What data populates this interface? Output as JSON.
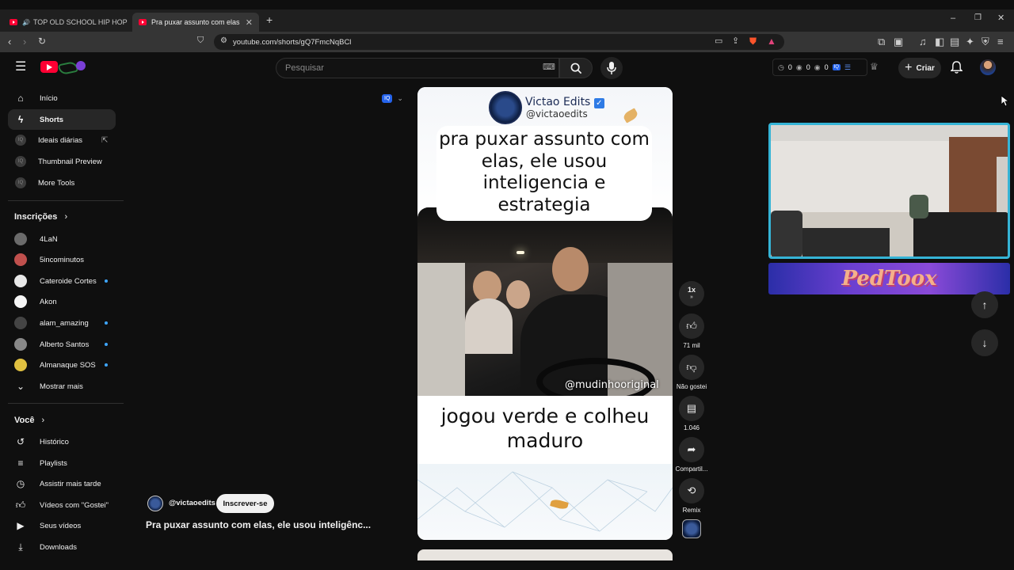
{
  "browser": {
    "tabs": [
      {
        "label": "TOP OLD SCHOOL HIP HOP 🔥 5",
        "active": false
      },
      {
        "label": "Pra puxar assunto com elas, ele",
        "active": true
      }
    ],
    "url": "youtube.com/shorts/gQ7FmcNqBCl"
  },
  "header": {
    "search_placeholder": "Pesquisar",
    "counters": [
      "0",
      "0",
      "0"
    ],
    "create_label": "Criar"
  },
  "sidebar": {
    "main": [
      {
        "label": "Início",
        "icon": "home-icon"
      },
      {
        "label": "Shorts",
        "icon": "shorts-icon",
        "selected": true
      },
      {
        "label": "Ideais diárias",
        "icon": "iq-icon"
      },
      {
        "label": "Thumbnail Preview",
        "icon": "iq-icon"
      },
      {
        "label": "More Tools",
        "icon": "iq-icon"
      }
    ],
    "subscriptions_title": "Inscrições",
    "subscriptions": [
      {
        "label": "4LaN",
        "color": "#6b6b6b",
        "new": false
      },
      {
        "label": "5incominutos",
        "color": "#c0504d",
        "new": false
      },
      {
        "label": "Cateroide Cortes",
        "color": "#e8e8e8",
        "new": true
      },
      {
        "label": "Akon",
        "color": "#f5f5f5",
        "new": false
      },
      {
        "label": "alam_amazing",
        "color": "#444444",
        "new": true
      },
      {
        "label": "Alberto Santos",
        "color": "#888888",
        "new": true
      },
      {
        "label": "Almanaque SOS",
        "color": "#e0c040",
        "new": true
      }
    ],
    "show_more": "Mostrar mais",
    "you_title": "Você",
    "you": [
      {
        "label": "Histórico",
        "icon": "history-icon"
      },
      {
        "label": "Playlists",
        "icon": "playlists-icon"
      },
      {
        "label": "Assistir mais tarde",
        "icon": "clock-icon"
      },
      {
        "label": "Vídeos com \"Gostei\"",
        "icon": "like-icon"
      },
      {
        "label": "Seus vídeos",
        "icon": "video-icon"
      },
      {
        "label": "Downloads",
        "icon": "download-icon"
      }
    ]
  },
  "short": {
    "channel_name": "Victao Edits",
    "channel_handle": "@victaoedits",
    "top_caption": "pra puxar assunto com elas, ele usou inteligencia e estrategia",
    "video_watermark": "@mudinhooriginal",
    "bottom_caption": "jogou verde e colheu maduro",
    "author": "@victaoedits",
    "subscribe_label": "Inscrever-se",
    "title": "Pra puxar assunto com elas, ele usou inteligênc..."
  },
  "actions": {
    "speed": "1x",
    "likes": "71 mil",
    "dislike_label": "Não gostei",
    "comments": "1.046",
    "share_label": "Compartil...",
    "remix_label": "Remix"
  },
  "overlay": {
    "banner_text": "PedToox"
  }
}
